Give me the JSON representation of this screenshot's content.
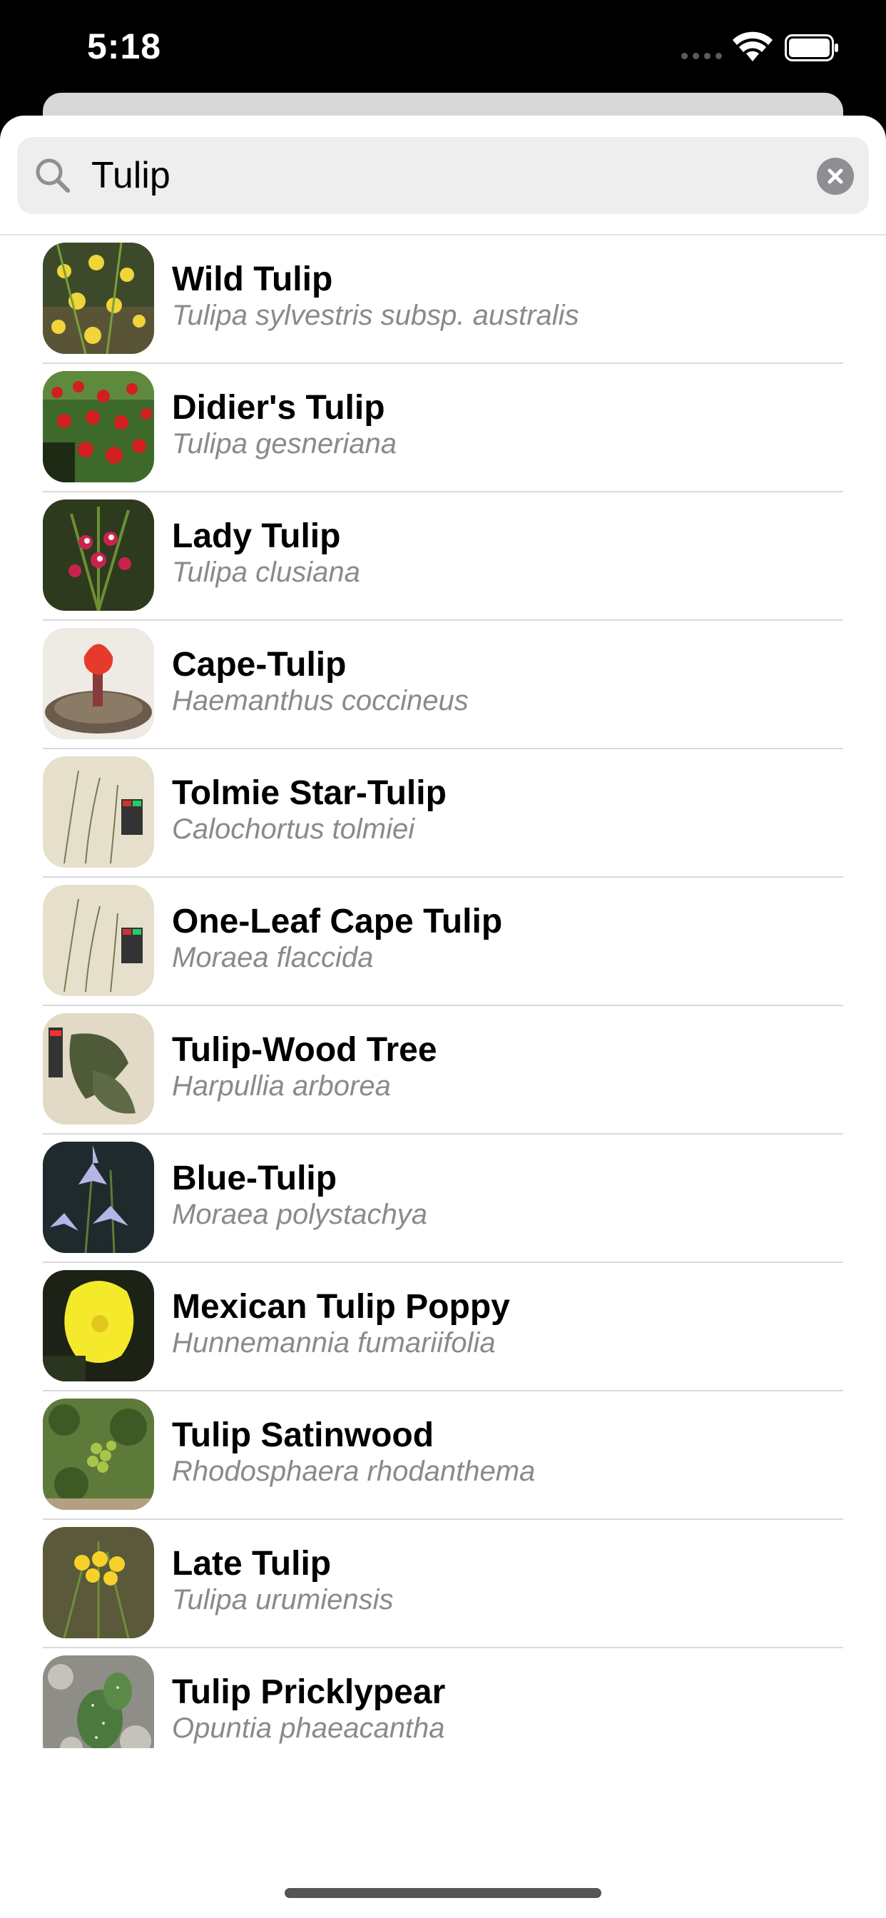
{
  "status_bar": {
    "time": "5:18"
  },
  "search": {
    "query": "Tulip",
    "placeholder": "Search"
  },
  "results": [
    {
      "common": "Wild Tulip",
      "scientific": "Tulipa sylvestris subsp. australis",
      "photo": "yellow-wildflowers-photo"
    },
    {
      "common": "Didier's Tulip",
      "scientific": "Tulipa gesneriana",
      "photo": "red-tulip-field-photo"
    },
    {
      "common": "Lady Tulip",
      "scientific": "Tulipa clusiana",
      "photo": "pink-flowers-photo"
    },
    {
      "common": "Cape-Tulip",
      "scientific": "Haemanthus coccineus",
      "photo": "red-bloom-pot-photo"
    },
    {
      "common": "Tolmie Star-Tulip",
      "scientific": "Calochortus tolmiei",
      "photo": "herbarium-sheet-photo"
    },
    {
      "common": "One-Leaf Cape Tulip",
      "scientific": "Moraea flaccida",
      "photo": "herbarium-sheet-photo"
    },
    {
      "common": "Tulip-Wood Tree",
      "scientific": "Harpullia arborea",
      "photo": "herbarium-leaves-photo"
    },
    {
      "common": "Blue-Tulip",
      "scientific": "Moraea polystachya",
      "photo": "blue-iris-flower-photo"
    },
    {
      "common": "Mexican Tulip Poppy",
      "scientific": "Hunnemannia fumariifolia",
      "photo": "yellow-poppy-photo"
    },
    {
      "common": "Tulip Satinwood",
      "scientific": "Rhodosphaera rhodanthema",
      "photo": "green-foliage-photo"
    },
    {
      "common": "Late Tulip",
      "scientific": "Tulipa urumiensis",
      "photo": "yellow-star-flowers-photo"
    },
    {
      "common": "Tulip Pricklypear",
      "scientific": "Opuntia phaeacantha",
      "photo": "cactus-rocks-photo"
    }
  ]
}
